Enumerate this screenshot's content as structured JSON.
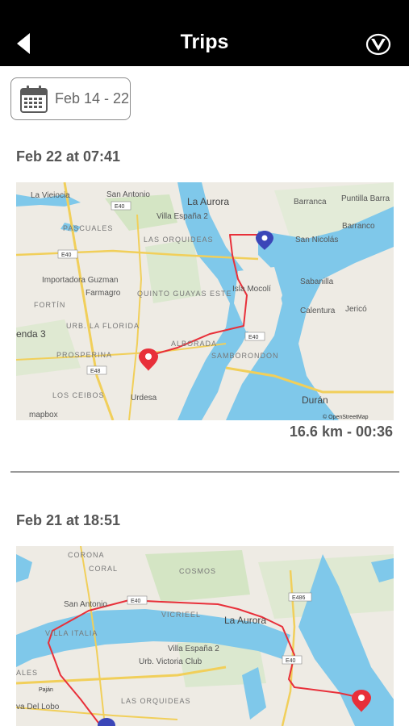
{
  "header": {
    "title": "Trips",
    "back_icon": "back-arrow-icon",
    "logo_icon": "brand-logo-icon"
  },
  "filter": {
    "date_range": "Feb 14 - 22",
    "icon": "calendar-icon"
  },
  "colors": {
    "header_bg": "#000000",
    "route": "#e8303a",
    "start_pin": "#3b46b8",
    "end_pin": "#e8303a",
    "water": "#7fc8ea",
    "text": "#555555"
  },
  "trips": [
    {
      "heading": "Feb 22 at 07:41",
      "stats": "16.6 km - 00:36",
      "map": {
        "places": {
          "la_vieiocia": "La Vieiocia",
          "san_antonio": "San Antonio",
          "la_aurora": "La Aurora",
          "barranca": "Barranca",
          "puntilla_barra": "Puntilla Barra",
          "barranco": "Barranco",
          "pascuales": "PASCUALES",
          "villa_espana": "Villa España 2",
          "las_orquideas": "LAS ORQUIDEAS",
          "san_nicolas": "San Nicolás",
          "importadora": "Importadora Guzman",
          "farmagro": "Farmagro",
          "quinto_guayas": "QUINTO GUAYAS ESTE",
          "isla_mocoli": "Isla Mocolí",
          "sabanilla": "Sabanilla",
          "fortin": "FORTÍN",
          "calentura": "Calentura",
          "jerico": "Jericó",
          "hacienda": "enda 3",
          "urb_la_florida": "URB. LA FLORIDA",
          "alborada": "ALBORADA",
          "prosperina": "PROSPERINA",
          "samborondon": "SAMBORONDON",
          "los_ceibos": "LOS CEIBOS",
          "urdesa": "Urdesa",
          "duran": "Durán"
        },
        "roads": [
          "E40",
          "E40",
          "E48",
          "E40"
        ],
        "attribution_left": "mapbox",
        "attribution_right": "© OpenStreetMap"
      }
    },
    {
      "heading": "Feb 21 at 18:51",
      "map": {
        "places": {
          "corona": "CORONA",
          "coral": "CORAL",
          "cosmos": "COSMOS",
          "san_antonio": "San Antonio",
          "vicriel": "VICRIEEL",
          "la_aurora": "La Aurora",
          "villa_espana": "Villa España 2",
          "urb_victoria": "Urb. Victoria Club",
          "villa_italia": "VILLA ITALIA",
          "ales": "ALES",
          "las_orquideas": "LAS ORQUIDEAS",
          "va_del_lobo": "va Del Lobo",
          "pajan": "Paján"
        },
        "roads": [
          "E40",
          "E486",
          "E40"
        ]
      }
    }
  ]
}
